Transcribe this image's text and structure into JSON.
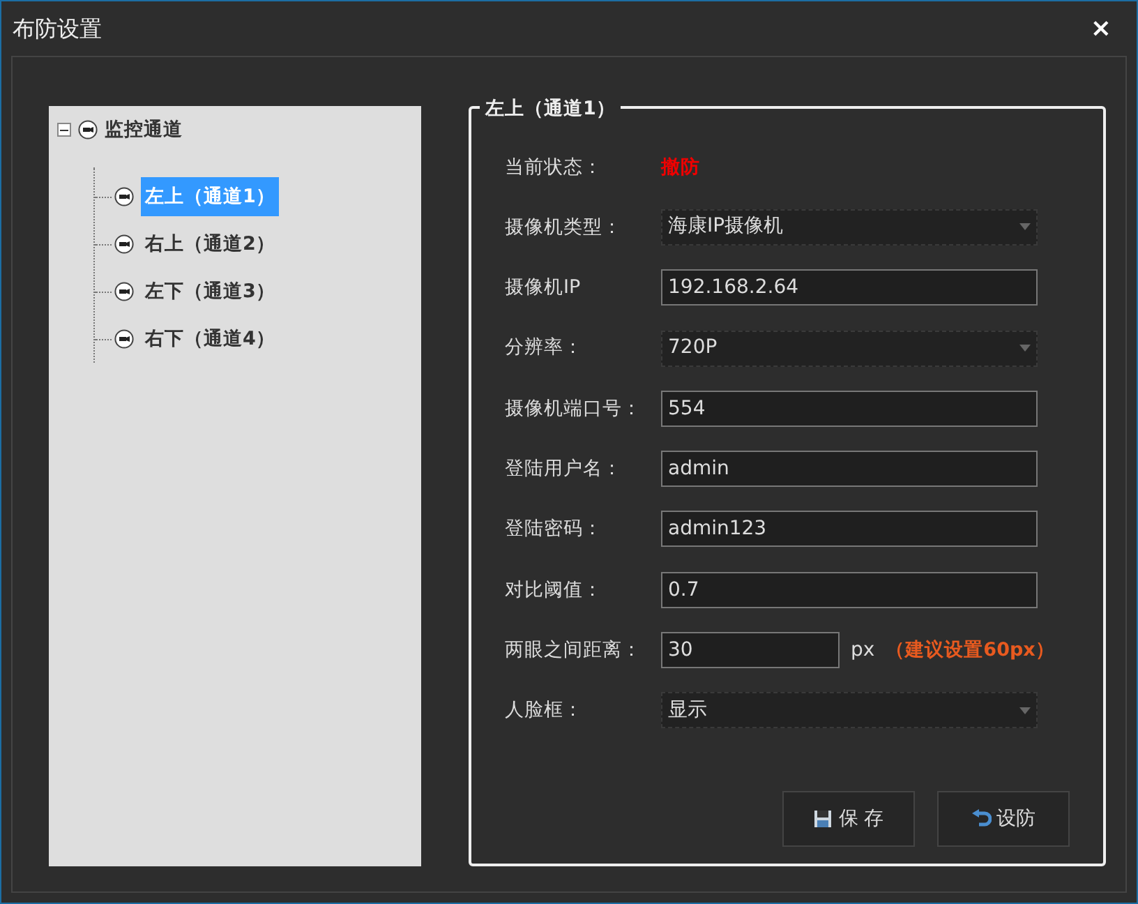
{
  "window": {
    "title": "布防设置",
    "close": "×"
  },
  "tree": {
    "label": "监控通道",
    "expanded": true,
    "children": [
      {
        "label": "左上（通道1）",
        "selected": true
      },
      {
        "label": "右上（通道2）",
        "selected": false
      },
      {
        "label": "左下（通道3）",
        "selected": false
      },
      {
        "label": "右下（通道4）",
        "selected": false
      }
    ]
  },
  "group": {
    "title": "左上（通道1）"
  },
  "fields": [
    {
      "kind": "status",
      "label": "当前状态：",
      "value": "撤防"
    },
    {
      "kind": "select",
      "label": "摄像机类型：",
      "value": "海康IP摄像机"
    },
    {
      "kind": "input",
      "label": "摄像机IP",
      "value": "192.168.2.64"
    },
    {
      "kind": "select",
      "label": "分辨率：",
      "value": "720P"
    },
    {
      "kind": "input",
      "label": "摄像机端口号：",
      "value": "554"
    },
    {
      "kind": "input",
      "label": "登陆用户名：",
      "value": "admin"
    },
    {
      "kind": "input",
      "label": "登陆密码：",
      "value": "admin123"
    },
    {
      "kind": "input",
      "label": "对比阈值：",
      "value": "0.7"
    },
    {
      "kind": "unit",
      "label": "两眼之间距离：",
      "value": "30",
      "unit": "px",
      "hint": "（建议设置60px）"
    },
    {
      "kind": "select",
      "label": "人脸框：",
      "value": "显示"
    }
  ],
  "buttons": [
    {
      "kind": "save",
      "label": "保 存"
    },
    {
      "kind": "undo",
      "label": "设防"
    }
  ]
}
